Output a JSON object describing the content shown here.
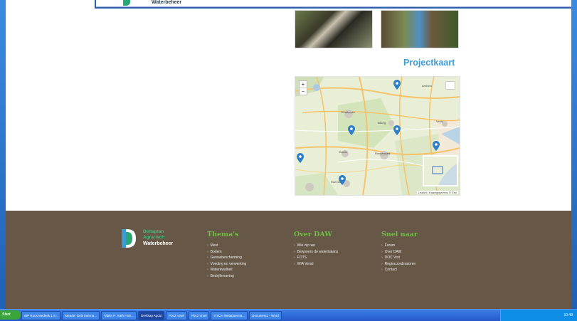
{
  "header": {
    "logo_text": "Waterbeheer"
  },
  "projectmap": {
    "title": "Projectkaart",
    "zoom_in": "+",
    "zoom_out": "−",
    "attribution": "Leaflet | Kaartgegevens © Esri",
    "place_labels": [
      "Arnhem",
      "Eindhoven",
      "Tilburg",
      "Breda",
      "Roosendaal",
      "Venlo",
      "Roermond"
    ]
  },
  "footer": {
    "logo": {
      "line1": "Deltaplan",
      "line2": "Agrarisch",
      "line3": "Waterbeheer"
    },
    "columns": [
      {
        "title": "Thema's",
        "items": [
          "Mest",
          "Bodem",
          "Gewasbescherming",
          "Voeding en verwerking",
          "Waterkwaliteit",
          "Bedrijfsvoering"
        ]
      },
      {
        "title": "Over DAW",
        "items": [
          "Wie zijn we",
          "Bewoners de waterbalans",
          "FOTS",
          "WIA Vensl"
        ]
      },
      {
        "title": "Snel naar",
        "items": [
          "Forum",
          "Over DAW",
          "DOC Vrst",
          "Regiocoordinatoren",
          "Contact"
        ]
      }
    ]
  },
  "taskbar": {
    "start_label": "Start",
    "tasks": [
      "IBP Roos Medeek 1.6...",
      "Meade: Gels Interna...",
      "Tablet P: Kath Fum...",
      "Drekkag Agdul",
      "Pbc2 Vrsel",
      "Pbc2 Vrsel",
      "2 SCH Weiapuerma...",
      "Document1 - Word"
    ],
    "active_task_index": 3,
    "clock": "10:48"
  },
  "colors": {
    "accent_blue": "#3a9bd6",
    "footer_brown": "#665747",
    "footer_green": "#6fbf44",
    "marker_blue": "#2f7fc8"
  }
}
